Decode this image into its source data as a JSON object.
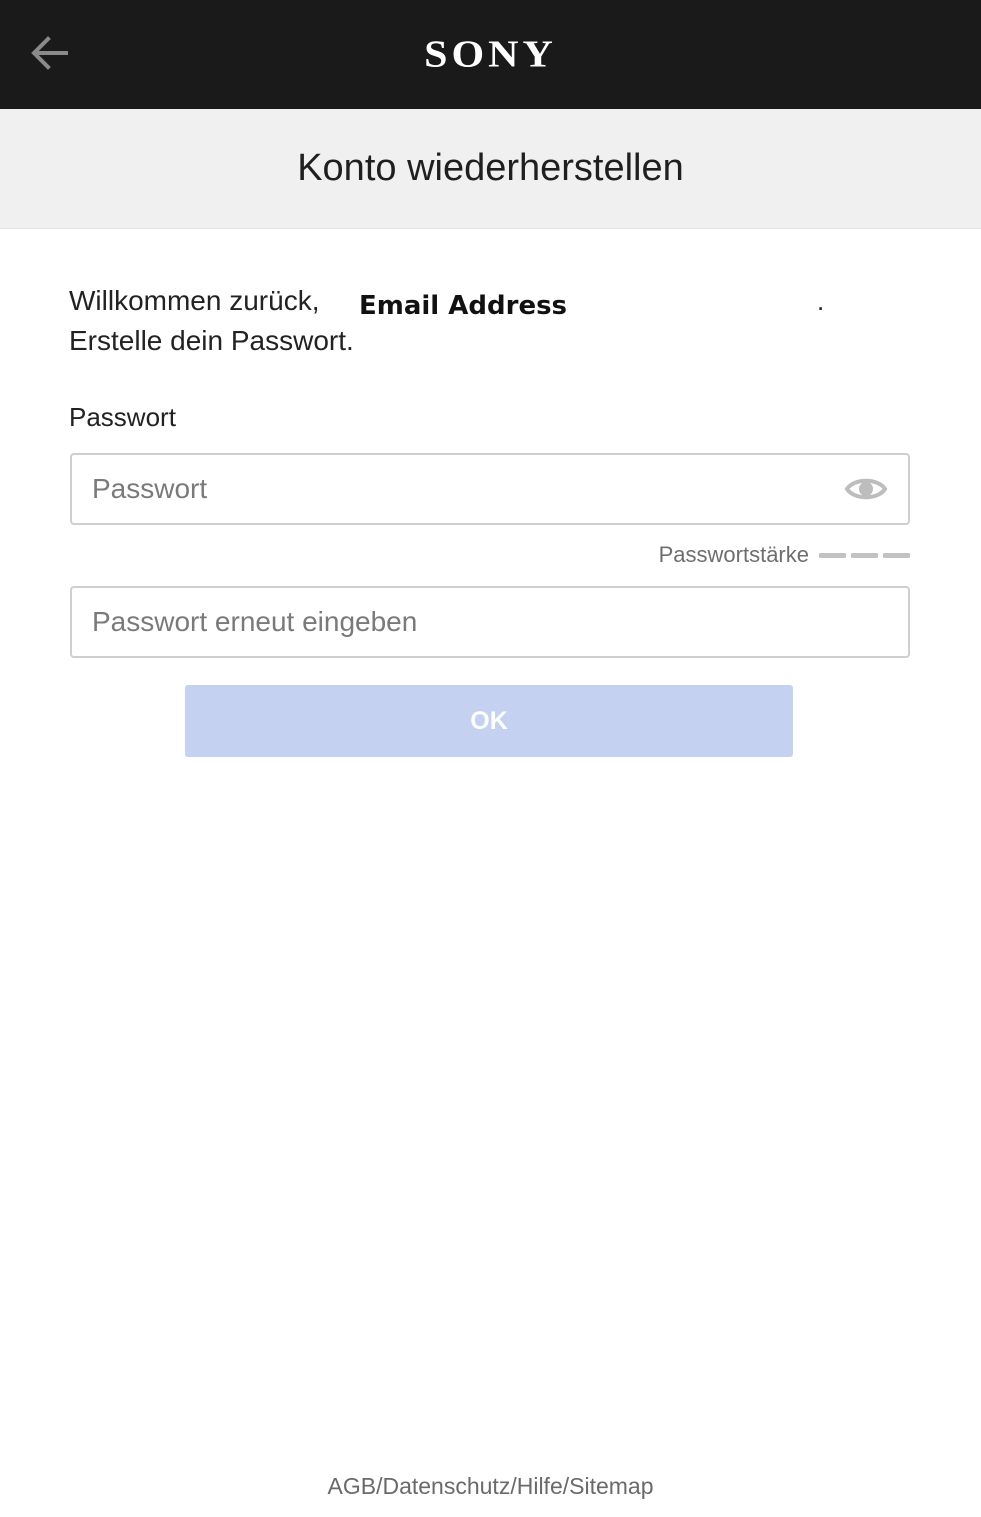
{
  "header": {
    "back_icon": "arrow-left-icon",
    "brand": "SONY"
  },
  "page": {
    "title": "Konto wiederherstellen"
  },
  "welcome": {
    "greeting": "Willkommen zurück,",
    "email": "Email Address",
    "punctuation": ".",
    "instruction": "Erstelle dein Passwort."
  },
  "form": {
    "password_label": "Passwort",
    "password_placeholder": "Passwort",
    "password_value": "",
    "toggle_icon": "eye-icon",
    "strength_label": "Passwortstärke",
    "strength_level": 0,
    "confirm_placeholder": "Passwort erneut eingeben",
    "confirm_value": "",
    "submit_label": "OK"
  },
  "footer": {
    "links": [
      "AGB",
      "Datenschutz",
      "Hilfe",
      "Sitemap"
    ],
    "separator": "/"
  },
  "colors": {
    "header_bg": "#1a1a1a",
    "title_bg": "#f0f0f0",
    "button_disabled": "#c5d1f1"
  }
}
